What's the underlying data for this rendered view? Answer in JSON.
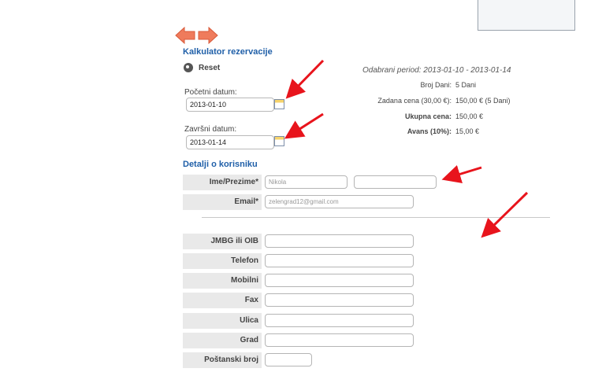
{
  "calculator": {
    "title": "Kalkulator rezervacije",
    "reset_label": "Reset",
    "start_label": "Početni datum:",
    "start_value": "2013-01-10",
    "end_label": "Završni datum:",
    "end_value": "2013-01-14"
  },
  "summary": {
    "period": "Odabrani period: 2013-01-10  -  2013-01-14",
    "rows": [
      {
        "label": "Broj Dani:",
        "value": "5 Dani"
      },
      {
        "label": "Zadana cena (30,00 €):",
        "value": "150,00 € (5 Dani)"
      },
      {
        "label": "Ukupna cena:",
        "value": "150,00 €"
      },
      {
        "label": "Avans (10%):",
        "value": "15,00 €"
      }
    ]
  },
  "user_details": {
    "title": "Detalji o korisniku",
    "name_label": "Ime/Prezime*",
    "first_name_value": "Nikola",
    "last_name_value": "",
    "email_label": "Email*",
    "email_value": "zelengrad12@gmail.com",
    "fields": [
      {
        "label": "JMBG ili OIB",
        "value": ""
      },
      {
        "label": "Telefon",
        "value": ""
      },
      {
        "label": "Mobilni",
        "value": ""
      },
      {
        "label": "Fax",
        "value": ""
      },
      {
        "label": "Ulica",
        "value": ""
      },
      {
        "label": "Grad",
        "value": ""
      },
      {
        "label": "Poštanski broj",
        "value": ""
      }
    ]
  },
  "icons": {
    "back": "arrow-left-icon",
    "forward": "arrow-right-icon",
    "reset": "reset-icon",
    "calendar": "calendar-icon"
  },
  "colors": {
    "heading": "#1f5fa8",
    "nav_arrow": "#ef7b5c",
    "annotation": "#e8141c",
    "label_bg": "#e9e9e9"
  }
}
